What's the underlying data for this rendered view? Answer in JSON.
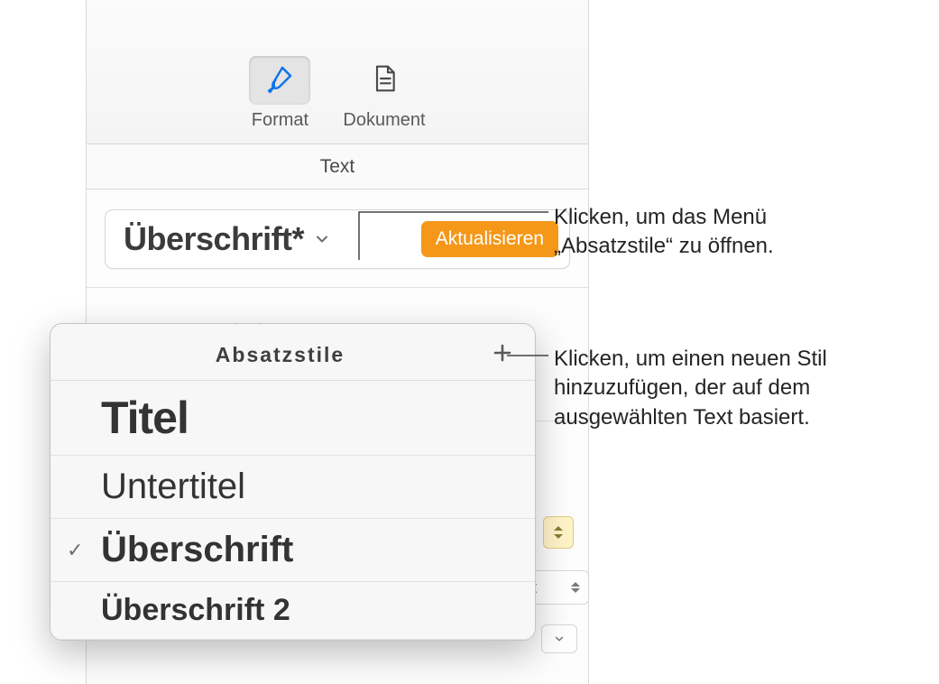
{
  "toolbar": {
    "format_label": "Format",
    "document_label": "Dokument"
  },
  "tab": {
    "text_label": "Text"
  },
  "style_picker": {
    "name": "Überschrift*",
    "update_label": "Aktualisieren"
  },
  "popover": {
    "title": "Absatzstile",
    "items": [
      {
        "label": "Titel",
        "class": "st-title",
        "checked": false
      },
      {
        "label": "Untertitel",
        "class": "st-sub",
        "checked": false
      },
      {
        "label": "Überschrift",
        "class": "st-h1",
        "checked": true
      },
      {
        "label": "Überschrift 2",
        "class": "st-h2",
        "checked": false
      }
    ]
  },
  "peek": {
    "size_suffix": "t"
  },
  "callouts": {
    "open_menu": "Klicken, um das Menü „Absatzstile“ zu öffnen.",
    "add_style": "Klicken, um einen neuen Stil hinzuzufügen, der auf dem ausgewählten Text basiert."
  }
}
